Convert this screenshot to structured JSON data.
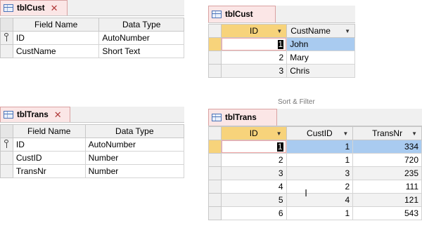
{
  "design_cust": {
    "tab": "tblCust",
    "headers": [
      "Field Name",
      "Data Type"
    ],
    "rows": [
      {
        "field": "ID",
        "type": "AutoNumber"
      },
      {
        "field": "CustName",
        "type": "Short Text"
      }
    ]
  },
  "design_trans": {
    "tab": "tblTrans",
    "headers": [
      "Field Name",
      "Data Type"
    ],
    "rows": [
      {
        "field": "ID",
        "type": "AutoNumber"
      },
      {
        "field": "CustID",
        "type": "Number"
      },
      {
        "field": "TransNr",
        "type": "Number"
      }
    ]
  },
  "sheet_cust": {
    "tab": "tblCust",
    "headers": [
      "ID",
      "CustName"
    ],
    "rows": [
      {
        "id": "1",
        "name": "John"
      },
      {
        "id": "2",
        "name": "Mary"
      },
      {
        "id": "3",
        "name": "Chris"
      }
    ]
  },
  "sheet_trans": {
    "tab": "tblTrans",
    "headers": [
      "ID",
      "CustID",
      "TransNr"
    ],
    "rows": [
      {
        "id": "1",
        "custid": "1",
        "transnr": "334"
      },
      {
        "id": "2",
        "custid": "1",
        "transnr": "720"
      },
      {
        "id": "3",
        "custid": "3",
        "transnr": "235"
      },
      {
        "id": "4",
        "custid": "2",
        "transnr": "111"
      },
      {
        "id": "5",
        "custid": "4",
        "transnr": "121"
      },
      {
        "id": "6",
        "custid": "1",
        "transnr": "543"
      }
    ]
  },
  "ribbon_fragment": "Sort & Filter",
  "colors": {
    "tab_bg": "#fbe6e6",
    "key_col": "#f7d37b",
    "selection": "#a9cbf0"
  }
}
